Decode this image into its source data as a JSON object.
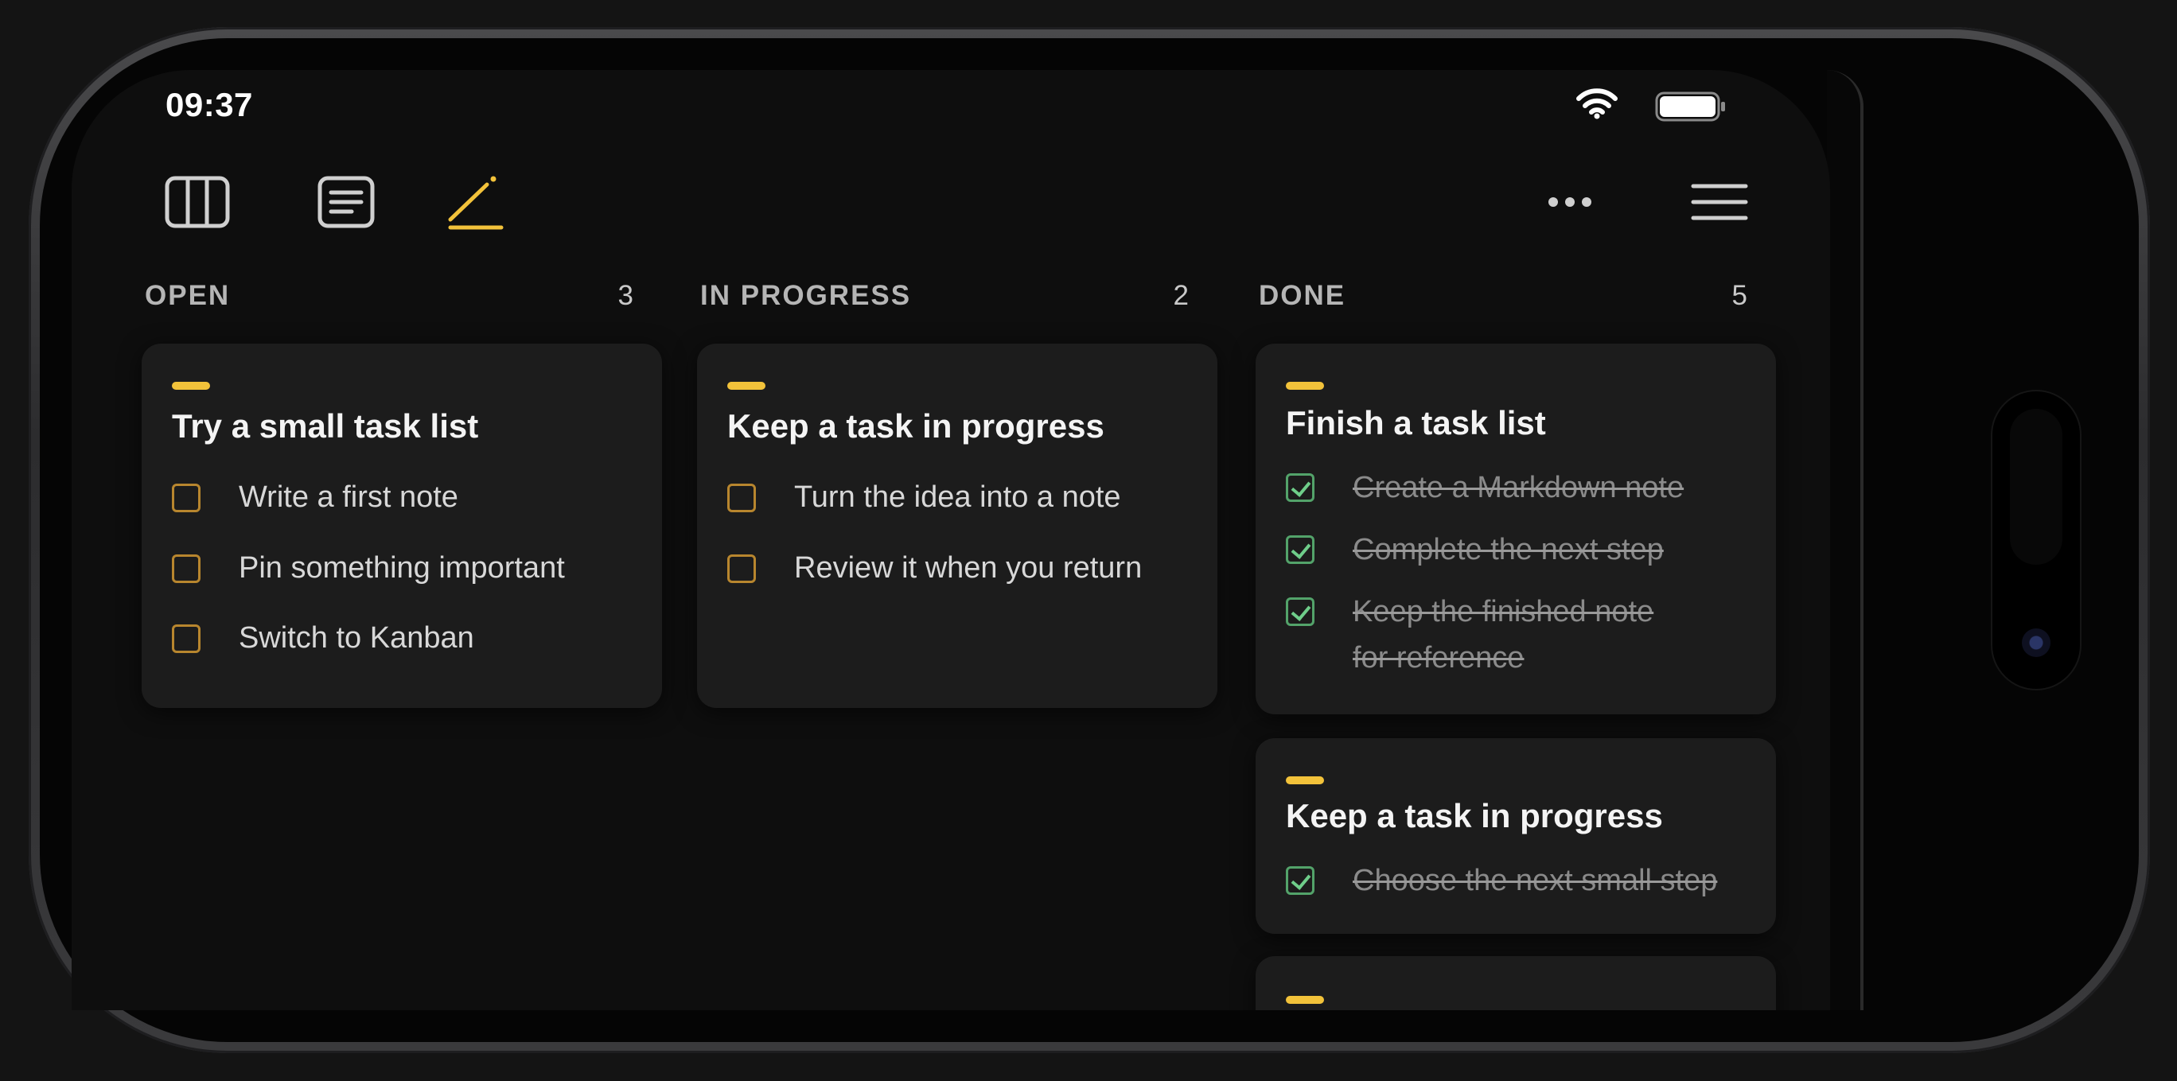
{
  "status": {
    "time": "09:37"
  },
  "toolbar": {
    "icons": [
      "board-icon",
      "note-icon",
      "edit-icon",
      "more-icon",
      "menu-icon"
    ],
    "accent": "#f2c23a"
  },
  "columns": [
    {
      "title": "OPEN",
      "count": "3",
      "cards": [
        {
          "title": "Try a small task list",
          "tasks": [
            {
              "text": "Write a first note",
              "done": false
            },
            {
              "text": "Pin something important",
              "done": false
            },
            {
              "text": "Switch to Kanban",
              "done": false
            }
          ]
        }
      ]
    },
    {
      "title": "IN PROGRESS",
      "count": "2",
      "cards": [
        {
          "title": "Keep a task in progress",
          "tasks": [
            {
              "text": "Turn the idea into a note",
              "done": false
            },
            {
              "text": "Review it when you return",
              "done": false
            }
          ]
        }
      ]
    },
    {
      "title": "DONE",
      "count": "5",
      "cards": [
        {
          "title": "Finish a task list",
          "tasks": [
            {
              "text": "Create a Markdown note",
              "done": true
            },
            {
              "text": "Complete the next step",
              "done": true
            },
            {
              "text": "Keep the finished note for reference",
              "done": true
            }
          ]
        },
        {
          "title": "Keep a task in progress",
          "tasks": [
            {
              "text": "Choose the next small step",
              "done": true
            }
          ]
        }
      ]
    }
  ],
  "colors": {
    "background": "#0e0e0e",
    "card": "#1c1c1c",
    "accent": "#f2c23a",
    "open_checkbox": "#b8862e",
    "done_checkbox": "#53a36a"
  }
}
